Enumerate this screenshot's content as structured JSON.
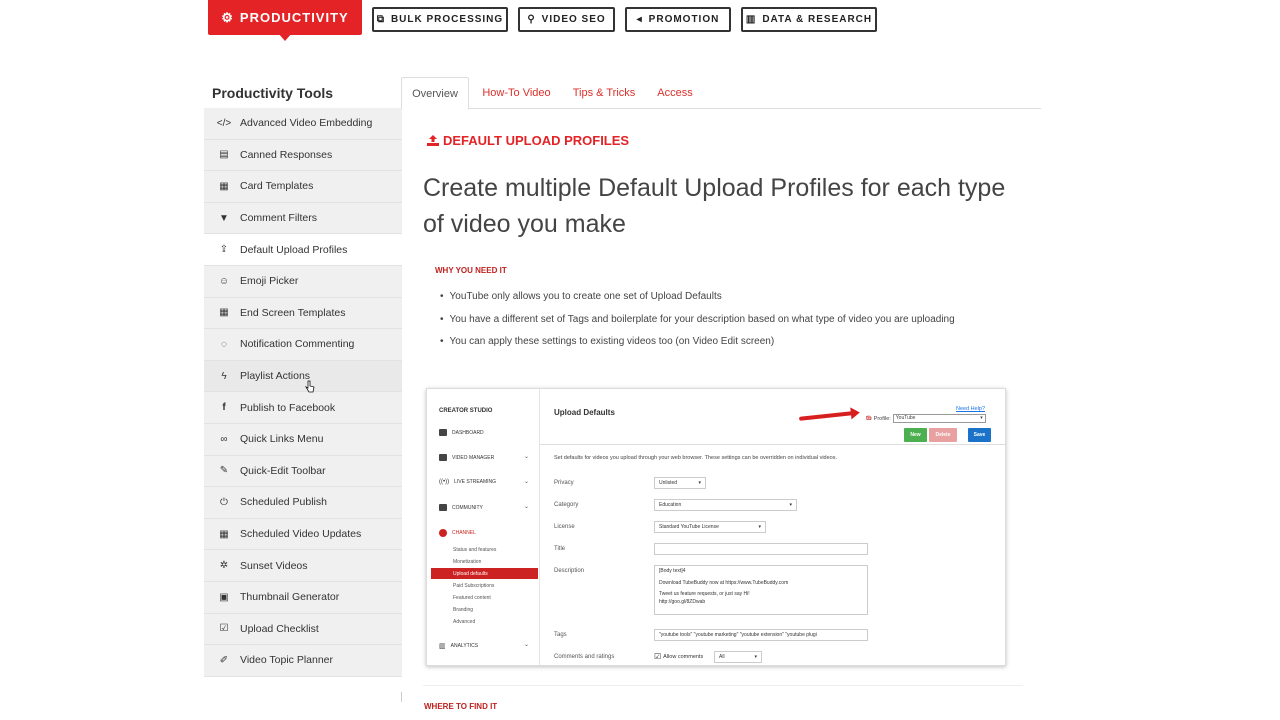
{
  "top_nav": {
    "categories": [
      {
        "label": "PRODUCTIVITY",
        "icon": "gear-icon",
        "active": true
      },
      {
        "label": "BULK PROCESSING",
        "icon": "copy-icon"
      },
      {
        "label": "VIDEO SEO",
        "icon": "search-icon"
      },
      {
        "label": "PROMOTION",
        "icon": "megaphone-icon"
      },
      {
        "label": "DATA & RESEARCH",
        "icon": "bar-chart-icon"
      }
    ]
  },
  "sidebar": {
    "title": "Productivity Tools",
    "items": [
      {
        "label": "Advanced Video Embedding",
        "icon": "code-icon"
      },
      {
        "label": "Canned Responses",
        "icon": "document-icon"
      },
      {
        "label": "Card Templates",
        "icon": "grid-icon"
      },
      {
        "label": "Comment Filters",
        "icon": "filter-icon"
      },
      {
        "label": "Default Upload Profiles",
        "icon": "upload-icon",
        "active": true
      },
      {
        "label": "Emoji Picker",
        "icon": "smiley-icon"
      },
      {
        "label": "End Screen Templates",
        "icon": "grid-icon"
      },
      {
        "label": "Notification Commenting",
        "icon": "comment-icon"
      },
      {
        "label": "Playlist Actions",
        "icon": "bolt-icon",
        "hovered": true
      },
      {
        "label": "Publish to Facebook",
        "icon": "facebook-icon"
      },
      {
        "label": "Quick Links Menu",
        "icon": "link-icon"
      },
      {
        "label": "Quick-Edit Toolbar",
        "icon": "pencil-icon"
      },
      {
        "label": "Scheduled Publish",
        "icon": "power-icon"
      },
      {
        "label": "Scheduled Video Updates",
        "icon": "calendar-icon"
      },
      {
        "label": "Sunset Videos",
        "icon": "spinner-icon"
      },
      {
        "label": "Thumbnail Generator",
        "icon": "image-icon"
      },
      {
        "label": "Upload Checklist",
        "icon": "checkbox-icon"
      },
      {
        "label": "Video Topic Planner",
        "icon": "edit-icon"
      }
    ]
  },
  "tabs": [
    {
      "label": "Overview",
      "active": true
    },
    {
      "label": "How-To Video"
    },
    {
      "label": "Tips & Tricks"
    },
    {
      "label": "Access"
    }
  ],
  "main": {
    "section_heading": "DEFAULT UPLOAD PROFILES",
    "headline": "Create multiple Default Upload Profiles for each type of video you make",
    "why_heading": "WHY YOU NEED IT",
    "bullets": [
      "YouTube only allows you to create one set of Upload Defaults",
      "You have a different set of Tags and boilerplate for your description based on what type of video you are uploading",
      "You can apply these settings to existing videos too (on Video Edit screen)"
    ],
    "where_heading": "WHERE TO FIND IT"
  },
  "screenshot": {
    "nav_title": "CREATOR STUDIO",
    "nav_items": [
      "DASHBOARD",
      "VIDEO MANAGER",
      "LIVE STREAMING",
      "COMMUNITY",
      "CHANNEL",
      "ANALYTICS"
    ],
    "channel_sub": [
      "Status and features",
      "Monetization",
      "Upload defaults",
      "Paid Subscriptions",
      "Featured content",
      "Branding",
      "Advanced"
    ],
    "title": "Upload Defaults",
    "need_help": "Need Help?",
    "profile_label": "Profile:",
    "profile_logo": "tb",
    "profile_value": "YouTube",
    "buttons": {
      "new": "New",
      "delete": "Delete",
      "save": "Save"
    },
    "description": "Set defaults for videos you upload through your web browser. These settings can be overridden on individual videos.",
    "fields": {
      "privacy_label": "Privacy",
      "privacy_value": "Unlisted",
      "category_label": "Category",
      "category_value": "Education",
      "license_label": "License",
      "license_value": "Standard YouTube License",
      "title_label": "Title",
      "title_value": "",
      "description_label": "Description",
      "description_lines": [
        "[Body text]4",
        "Download TubeBuddy now at https://www.TubeBuddy.com",
        "Tweet us feature requests, or just say Hi!",
        "http://goo.gl/8ZDwab"
      ],
      "tags_label": "Tags",
      "tags_value": "\"youtube tools\" \"youtube marketing\" \"youtube extension\" \"youtube plugi",
      "comments_label": "Comments and ratings",
      "allow_comments": "Allow comments",
      "comments_value": "All"
    }
  },
  "colors": {
    "brand_red": "#e32326",
    "link_red": "#d9312c",
    "save_blue": "#1a73c8",
    "new_green": "#4caf50",
    "delete_pink": "#e8a0a0"
  }
}
